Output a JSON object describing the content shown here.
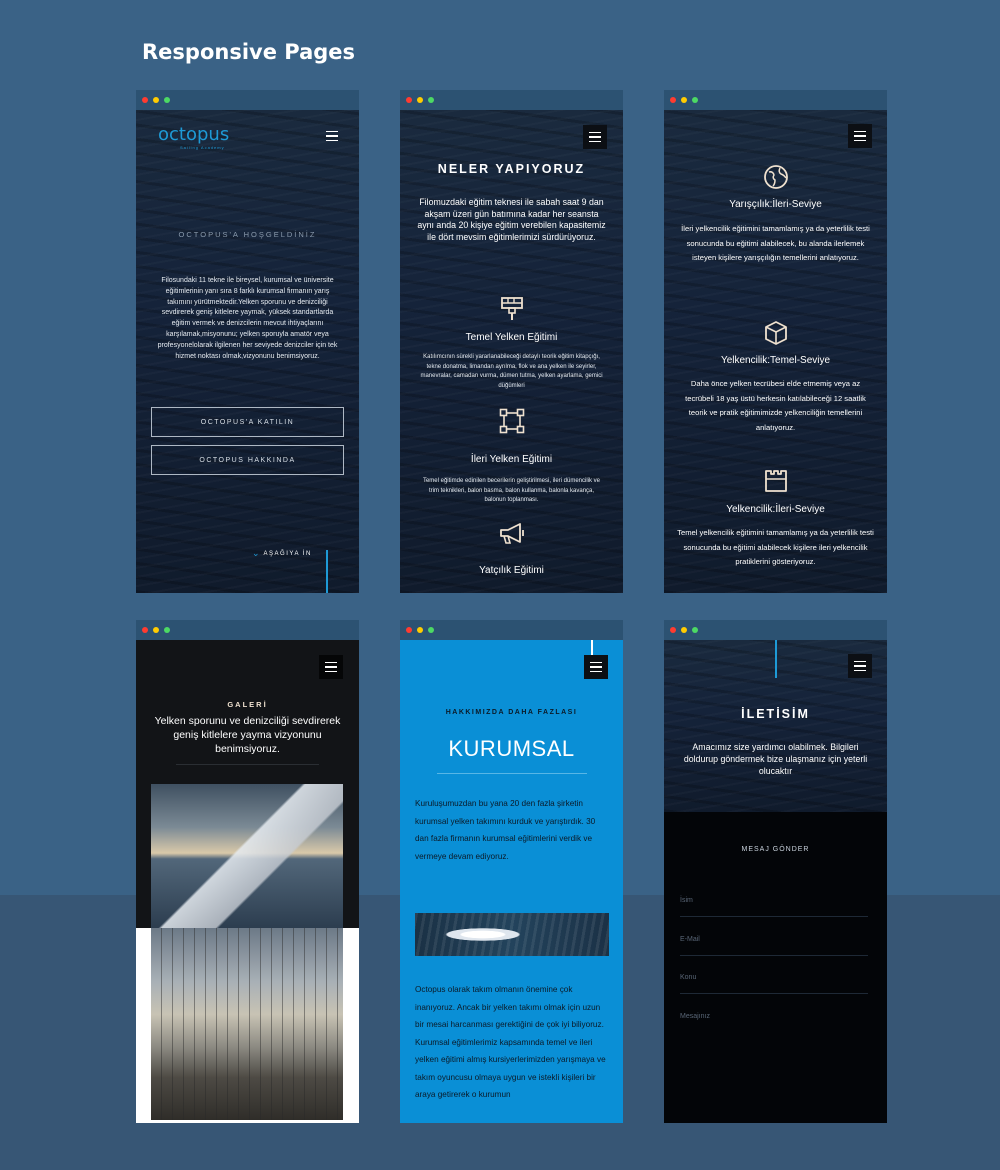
{
  "page_heading": "Responsive Pages",
  "colors": {
    "background": "#3a6286",
    "chrome": "#2c5272",
    "dot_red": "#ff3b30",
    "dot_yellow": "#ffcc00",
    "dot_green": "#4cd964",
    "accent_blue": "#0a8fd6"
  },
  "frame1": {
    "logo": "octopus",
    "logo_sub": "Sailing Academy",
    "welcome": "OCTOPUS'A HOŞGELDİNİZ",
    "body": "Filosundaki 11 tekne ile bireysel, kurumsal ve üniversite eğitimlerinin yanı sıra 8 farklı kurumsal firmanın yarış takımını yürütmektedir.Yelken sporunu ve denizciliği sevdirerek geniş kitlelere yaymak, yüksek standartlarda eğitim vermek ve denizcilerin mevcut ihtiyaçlarını karşılamak,misyonunu; yelken sporuyla amatör veya profesyonelolarak ilgilenen her seviyede denizciler için tek hizmet noktası olmak,vizyonunu benimsiyoruz.",
    "button_join": "OCTOPUS'A KATILIN",
    "button_about": "OCTOPUS HAKKINDA",
    "scroll_down": "AŞAĞIYA İN"
  },
  "frame2": {
    "title": "NELER YAPIYORUZ",
    "intro": "Filomuzdaki eğitim teknesi ile sabah saat 9 dan akşam üzeri gün batımına kadar her seansta aynı anda 20 kişiye eğitim verebilen kapasitemiz ile dört mevsim eğitimlerimizi sürdürüyoruz.",
    "services": [
      {
        "title": "Temel Yelken Eğitimi",
        "text": "Katılımcının sürekli yararlanabileceği detaylı teorik eğitim kitapçığı, tekne donatma, limandan ayrılma, flok ve ana yelken ile seyirler, manevralar, camadan vurma, dümen tutma, yelken ayarlama, gemici düğümleri",
        "icon": "paintbrush-icon"
      },
      {
        "title": "İleri Yelken Eğitimi",
        "text": "Temel eğitimde edinilen becerilerin geliştirilmesi, ileri dümencilik ve trim teknikleri, balon basma, balon kullanma, balonla kavança, balonun toplanması.",
        "icon": "vector-square-icon"
      },
      {
        "title": "Yatçılık Eğitimi",
        "icon": "megaphone-icon"
      }
    ]
  },
  "frame3": {
    "levels": [
      {
        "title": "Yarışçılık:İleri-Seviye",
        "text": "İleri yelkencilik eğitimini tamamlamış ya da yeterlilik testi sonucunda bu eğitimi alabilecek, bu alanda ilerlemek isteyen kişilere yarışçılığın temellerini anlatıyoruz.",
        "icon": "globe-icon"
      },
      {
        "title": "Yelkencilik:Temel-Seviye",
        "text": "Daha önce yelken tecrübesi elde etmemiş veya az tecrübeli 18 yaş üstü herkesin katılabileceği 12 saatlik teorik ve pratik eğitimimizde yelkenciliğin temellerini anlatıyoruz.",
        "icon": "cube-icon"
      },
      {
        "title": "Yelkencilik:İleri-Seviye",
        "text": "Temel yelkencilik eğitimini tamamlamış ya da yeterlilik testi sonucunda bu eğitimi alabilecek kişilere ileri yelkencilik pratiklerini gösteriyoruz.",
        "icon": "castle-icon"
      }
    ]
  },
  "frame4": {
    "title": "GALERİ",
    "text": "Yelken sporunu ve denizciliği sevdirerek geniş kitlelere yayma vizyonunu benimsiyoruz."
  },
  "frame5": {
    "kicker": "HAKKIMIZDA DAHA FAZLASI",
    "title": "KURUMSAL",
    "para1": "Kuruluşumuzdan bu yana 20 den fazla şirketin kurumsal yelken takımını kurduk ve yarıştırdık. 30 dan fazla firmanın kurumsal eğitimlerini verdik ve vermeye devam ediyoruz.",
    "para2": "Octopus olarak takım olmanın önemine çok inanıyoruz. Ancak bir yelken takımı olmak için uzun bir mesai harcanması gerektiğini de çok iyi biliyoruz. Kurumsal eğitimlerimiz kapsamında temel ve ileri yelken eğitimi almış kursiyerlerimizden yarışmaya ve takım oyuncusu olmaya uygun ve istekli kişileri bir araya getirerek o kurumun"
  },
  "frame6": {
    "title": "İLETİSİM",
    "intro": "Amacımız size yardımcı olabilmek. Bilgileri doldurup göndermek bize ulaşmanız için yeterli olucaktır",
    "form_title": "MESAJ GÖNDER",
    "fields": [
      "İsim",
      "E-Mail",
      "Konu",
      "Mesajınız"
    ]
  }
}
